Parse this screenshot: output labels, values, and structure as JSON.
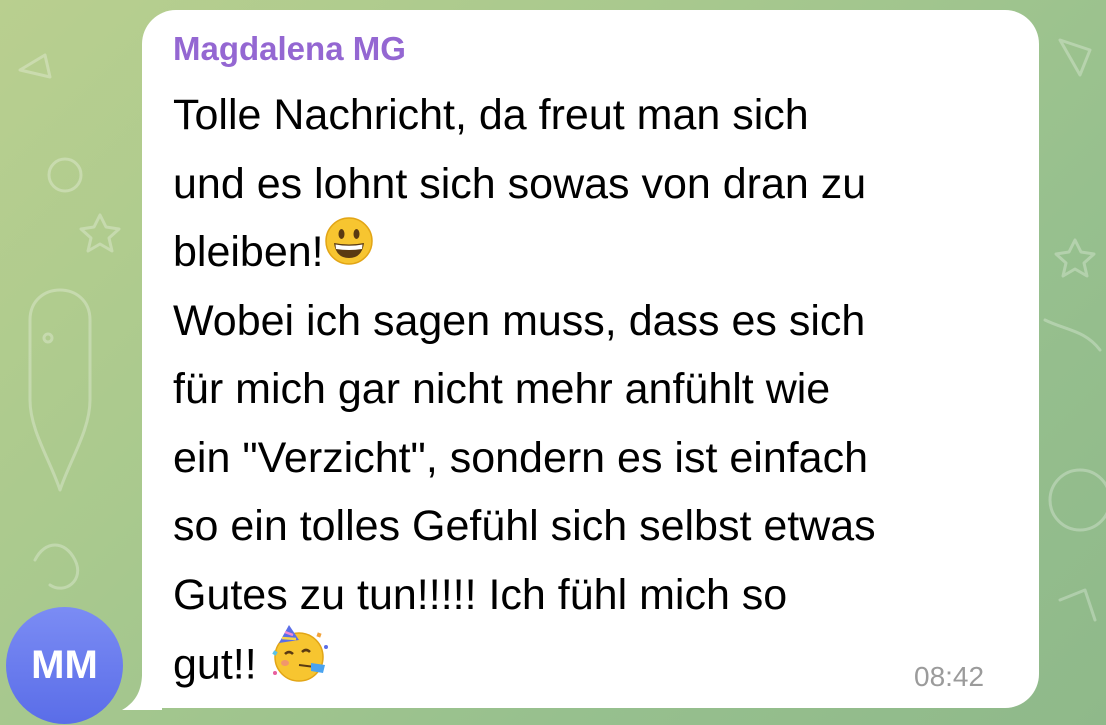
{
  "message": {
    "sender": "Magdalena MG",
    "lines": [
      "Tolle Nachricht, da freut man sich",
      "und es lohnt sich sowas von dran zu",
      "bleiben!",
      "Wobei ich sagen muss, dass es sich",
      "für mich gar nicht mehr anfühlt wie",
      "ein \"Verzicht\", sondern es ist einfach",
      "so ein tolles Gefühl sich selbst etwas",
      "Gutes zu tun!!!!! Ich fühl mich so",
      "gut!!"
    ],
    "emoji_1": "grinning-face-emoji",
    "emoji_2": "partying-face-emoji",
    "time": "08:42"
  },
  "avatar": {
    "initials": "MM",
    "color": "#6676ee"
  },
  "colors": {
    "sender": "#9467d2",
    "bubble": "#ffffff",
    "time": "#9b9b9b"
  }
}
